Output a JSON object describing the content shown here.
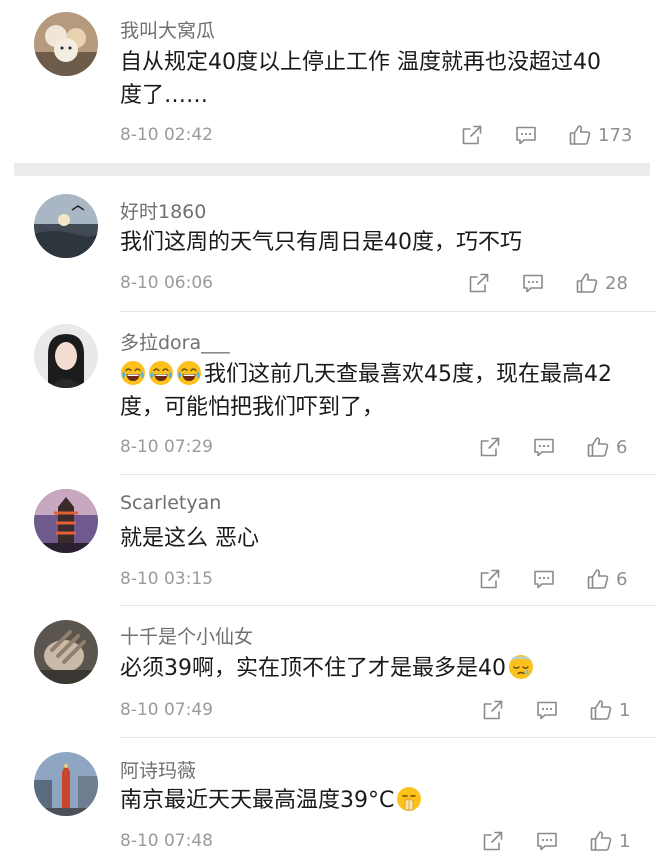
{
  "comments": [
    {
      "name": "我叫大窝瓜",
      "text": "自从规定40度以上停止工作 温度就再也没超过40度了……",
      "time": "8-10 02:42",
      "likes": "173"
    },
    {
      "name": "好时1860",
      "text": "我们这周的天气只有周日是40度，巧不巧",
      "time": "8-10 06:06",
      "likes": "28"
    },
    {
      "name": "多拉dora___",
      "text": "我们这前几天查最喜欢45度，现在最高42度，可能怕把我们吓到了，",
      "time": "8-10 07:29",
      "likes": "6"
    },
    {
      "name": "Scarletyan",
      "text": "就是这么 恶心",
      "time": "8-10 03:15",
      "likes": "6"
    },
    {
      "name": "十千是个小仙女",
      "text": "必须39啊，实在顶不住了才是最多是40",
      "time": "8-10 07:49",
      "likes": "1"
    },
    {
      "name": "阿诗玛薇",
      "text": "南京最近天天最高温度39°C",
      "time": "8-10 07:48",
      "likes": "1"
    }
  ],
  "icons": {
    "share": "share-icon",
    "reply": "comment-icon",
    "like": "thumbs-up-icon",
    "emoji_laugh": "tears-of-joy-emoji",
    "emoji_sweat": "cold-sweat-emoji",
    "emoji_pray": "praying-face-emoji"
  }
}
